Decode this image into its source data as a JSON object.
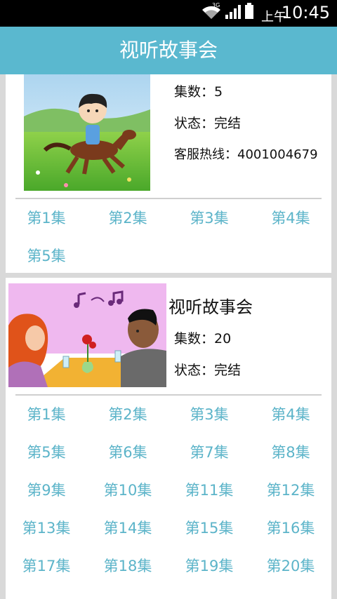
{
  "status_bar": {
    "network": "3G",
    "time_prefix": "上午",
    "time": "10:45"
  },
  "header": {
    "title": "视听故事会"
  },
  "cards": [
    {
      "title": "",
      "episodes_count_label": "集数：5",
      "status_label": "状态：完结",
      "hotline_label": "客服热线：4001004679",
      "episodes": [
        "第1集",
        "第2集",
        "第3集",
        "第4集",
        "第5集"
      ]
    },
    {
      "title": "视听故事会",
      "episodes_count_label": "集数：20",
      "status_label": "状态：完结",
      "episodes": [
        "第1集",
        "第2集",
        "第3集",
        "第4集",
        "第5集",
        "第6集",
        "第7集",
        "第8集",
        "第9集",
        "第10集",
        "第11集",
        "第12集",
        "第13集",
        "第14集",
        "第15集",
        "第16集",
        "第17集",
        "第18集",
        "第19集",
        "第20集"
      ]
    }
  ],
  "colors": {
    "header_bg": "#5ab8cf",
    "episode_link": "#5cb4c9",
    "page_bg": "#d9d9d9"
  }
}
